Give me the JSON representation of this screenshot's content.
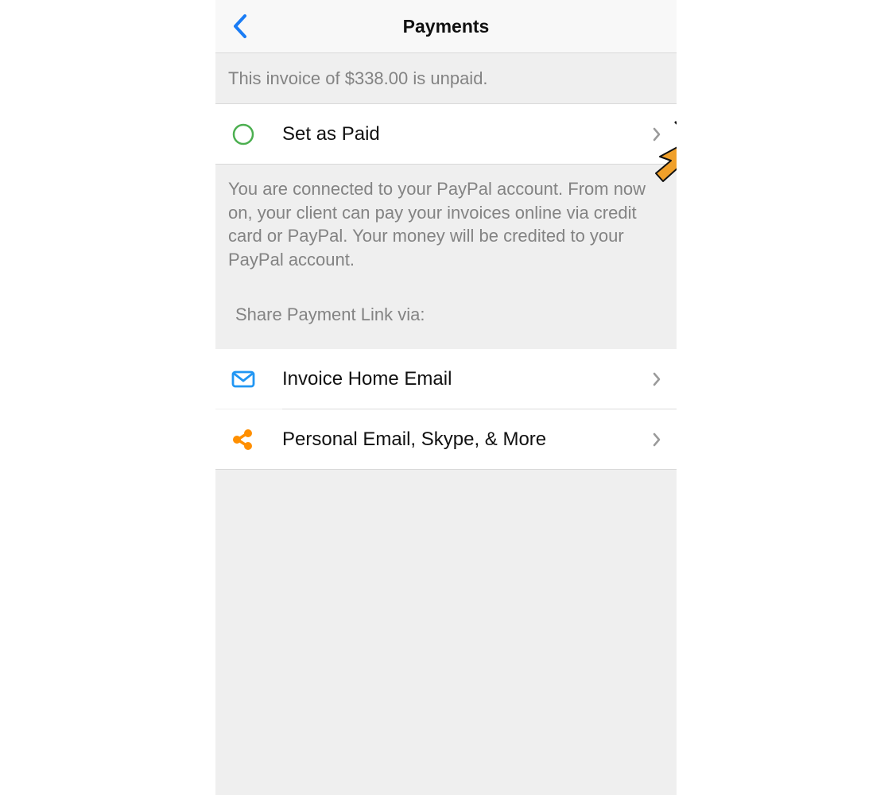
{
  "navbar": {
    "title": "Payments",
    "back_icon": "chevron-left-icon"
  },
  "status_message": "This invoice of $338.00 is unpaid.",
  "set_paid_row": {
    "label": "Set as Paid",
    "icon": "circle-outline-icon",
    "icon_color": "#4caf50"
  },
  "info_text": "You are connected to your PayPal account. From now on, your client can pay your invoices online via credit card or PayPal. Your money will be credited to your PayPal account.",
  "share": {
    "header": "Share Payment Link via:",
    "items": [
      {
        "label": "Invoice Home Email",
        "icon": "mail-icon",
        "icon_color": "#2196f3"
      },
      {
        "label": "Personal Email, Skype, & More",
        "icon": "share-icon",
        "icon_color": "#ff8f00"
      }
    ]
  },
  "colors": {
    "accent": "#1a7cf5",
    "cursor": "#f0a02a",
    "secondary_text": "#838383",
    "background": "#efefef"
  }
}
